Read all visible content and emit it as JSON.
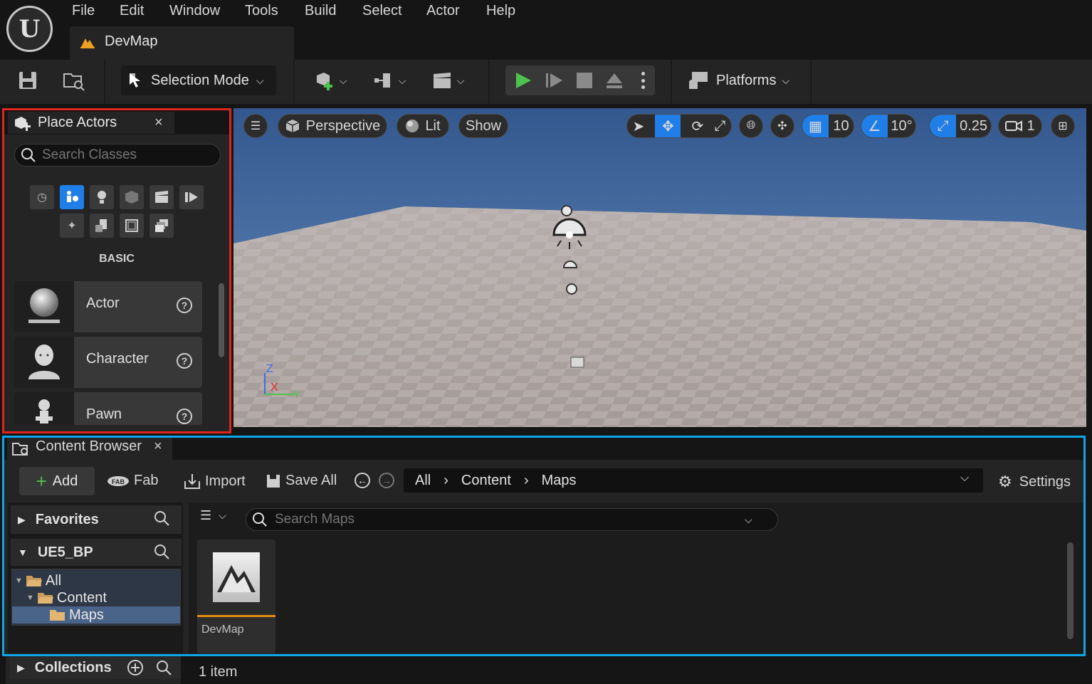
{
  "menu": [
    "File",
    "Edit",
    "Window",
    "Tools",
    "Build",
    "Select",
    "Actor",
    "Help"
  ],
  "logo_text": "U",
  "doc_tab": {
    "label": "DevMap"
  },
  "toolbar": {
    "selection_mode": "Selection Mode",
    "platforms": "Platforms"
  },
  "place_actors": {
    "title": "Place Actors",
    "close": "×",
    "search_placeholder": "Search Classes",
    "category_header": "BASIC",
    "help_glyph": "?",
    "items": [
      {
        "label": "Actor",
        "icon": "sphere-icon"
      },
      {
        "label": "Character",
        "icon": "character-icon"
      },
      {
        "label": "Pawn",
        "icon": "pawn-icon"
      }
    ]
  },
  "viewport": {
    "perspective": "Perspective",
    "lit": "Lit",
    "show": "Show",
    "grid_snap": "10",
    "rotation_snap": "10°",
    "scale_snap": "0.25",
    "camera_speed": "1",
    "axis": {
      "z": "Z",
      "x": "X",
      "y": "Y"
    },
    "colors": {
      "sky": "#42669a",
      "accent": "#1f7ee8"
    }
  },
  "content_browser": {
    "title": "Content Browser",
    "close": "×",
    "add": "Add",
    "fab": "Fab",
    "import": "Import",
    "save_all": "Save All",
    "path": [
      "All",
      "Content",
      "Maps"
    ],
    "settings": "Settings",
    "favorites": "Favorites",
    "project": "UE5_BP",
    "tree": [
      "All",
      "Content",
      "Maps"
    ],
    "search_placeholder": "Search Maps",
    "assets": [
      {
        "label": "DevMap"
      }
    ],
    "collections": "Collections",
    "item_count": "1 item"
  }
}
